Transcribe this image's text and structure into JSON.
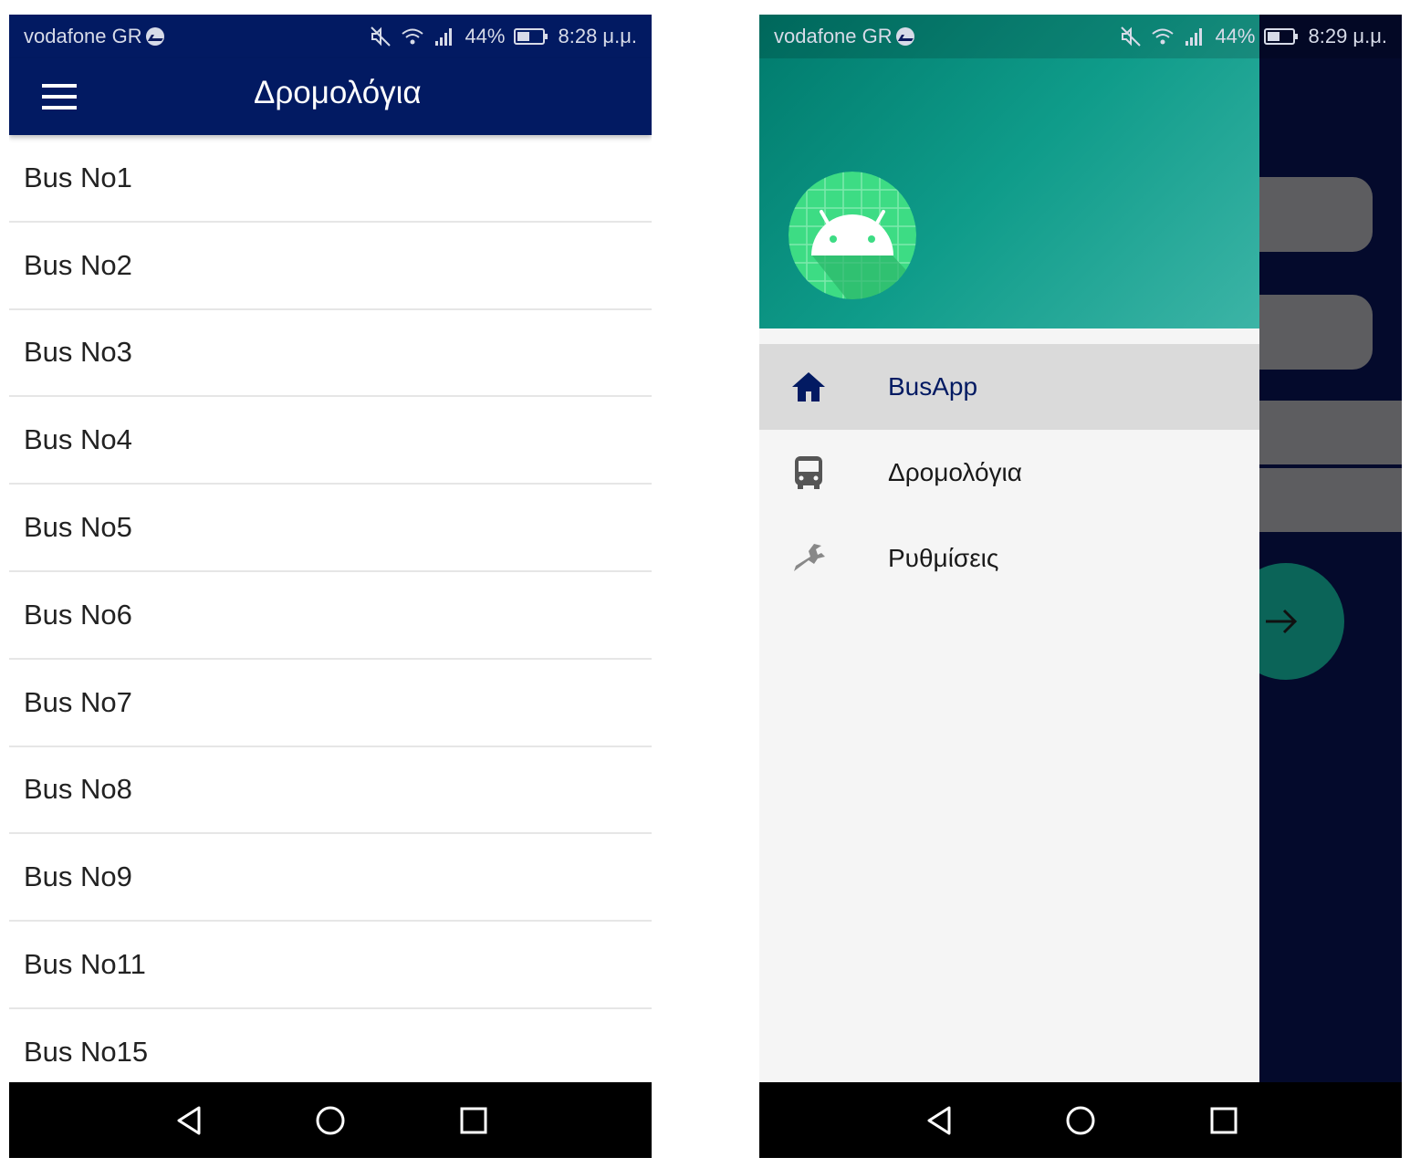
{
  "left_screen": {
    "status": {
      "carrier": "vodafone GR",
      "battery": "44%",
      "time": "8:28 μ.μ."
    },
    "appbar": {
      "title": "Δρομολόγια",
      "menu_icon": "hamburger-icon"
    },
    "routes": [
      "Bus No1",
      "Bus No2",
      "Bus No3",
      "Bus No4",
      "Bus No5",
      "Bus No6",
      "Bus No7",
      "Bus No8",
      "Bus No9",
      "Bus No11",
      "Bus No15"
    ],
    "nav_icons": [
      "back-icon",
      "home-icon",
      "recent-apps-icon"
    ]
  },
  "right_screen": {
    "status": {
      "carrier": "vodafone GR",
      "battery": "44%",
      "time": "8:29 μ.μ."
    },
    "drawer": {
      "header_avatar_icon": "android-icon",
      "items": [
        {
          "label": "BusApp",
          "icon": "home-icon",
          "active": true
        },
        {
          "label": "Δρομολόγια",
          "icon": "bus-icon",
          "active": false
        },
        {
          "label": "Ρυθμίσεις",
          "icon": "wrench-icon",
          "active": false
        }
      ]
    },
    "background_fab_icon": "arrow-right-icon",
    "nav_icons": [
      "back-icon",
      "home-icon",
      "recent-apps-icon"
    ]
  },
  "colors": {
    "appbar": "#021a62",
    "drawer_header_start": "#007a6c",
    "drawer_header_end": "#3cb4a6",
    "active_menu_bg": "#dadada",
    "active_menu_text": "#021a62"
  }
}
